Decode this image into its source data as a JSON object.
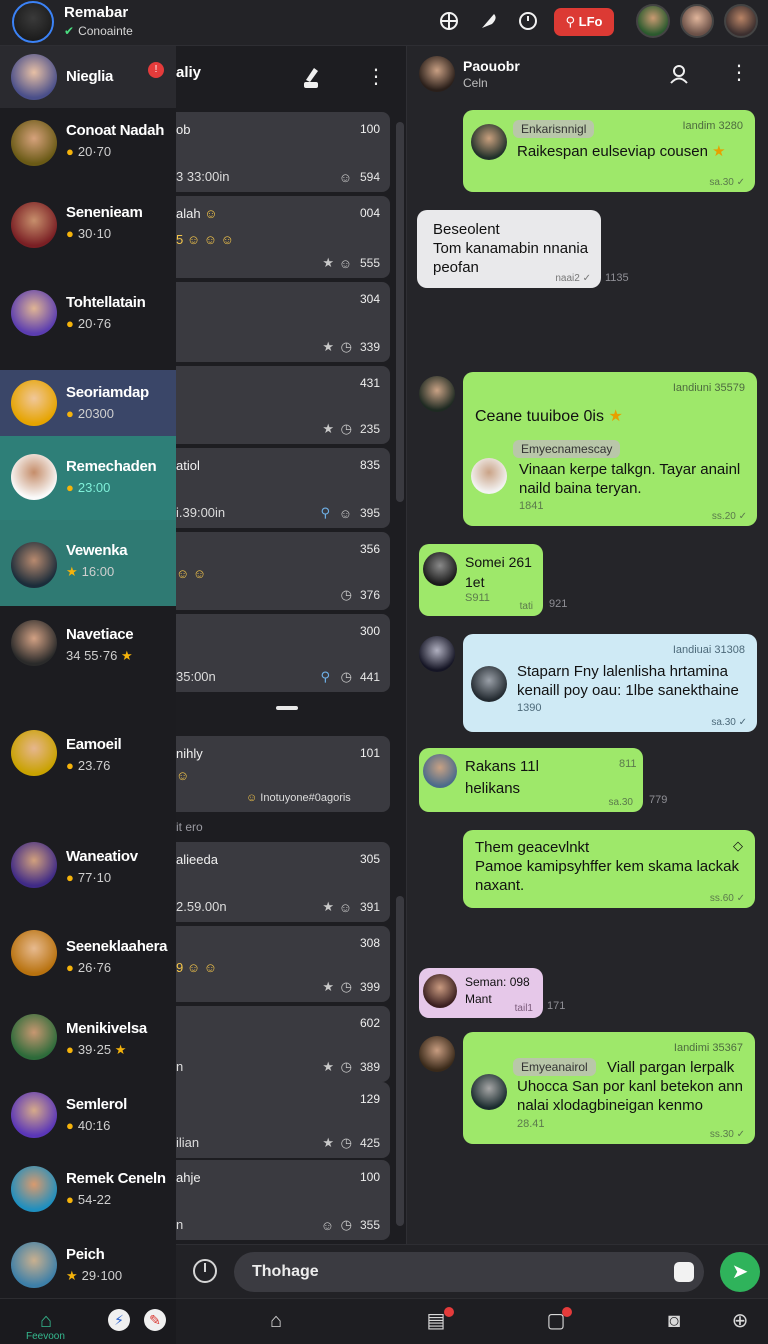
{
  "topbar": {
    "user_name": "Remabar",
    "user_status": "Conoainte",
    "live_label": "LFo"
  },
  "contacts": [
    {
      "name": "Nieglia",
      "sub": "",
      "badge": "!"
    },
    {
      "name": "Conoat Nadah",
      "sub": "20·70"
    },
    {
      "name": "Senenieam",
      "sub": "30·10"
    },
    {
      "name": "Tohtellatain",
      "sub": "20·76"
    },
    {
      "name": "Seoriamdap",
      "sub": "20300"
    },
    {
      "name": "Remechaden",
      "sub": "23:00"
    },
    {
      "name": "Vewenka",
      "sub": "16:00"
    },
    {
      "name": "Navetiace",
      "sub": "34 55·76"
    },
    {
      "name": "Eamoeil",
      "sub": "23.76"
    },
    {
      "name": "Waneatiov",
      "sub": "77·10"
    },
    {
      "name": "Seeneklaahera",
      "sub": "26·76"
    },
    {
      "name": "Menikivelsa",
      "sub": "39·25"
    },
    {
      "name": "Semlerol",
      "sub": "40:16"
    },
    {
      "name": "Remek Ceneln",
      "sub": "54-22"
    },
    {
      "name": "Peich",
      "sub": "29·100"
    }
  ],
  "middle": {
    "title": "aliy",
    "cards": [
      {
        "title": "ob",
        "num": "100",
        "sub": "3 33:00in",
        "count": "594"
      },
      {
        "title": "alah",
        "num": "004",
        "sub": "",
        "count": "555"
      },
      {
        "title": "",
        "num": "304",
        "sub": "",
        "count": "339"
      },
      {
        "title": "",
        "num": "431",
        "sub": "",
        "count": "235"
      },
      {
        "title": "atiol",
        "num": "835",
        "sub": "i.39:00in",
        "count": "395"
      },
      {
        "title": "",
        "num": "356",
        "sub": "",
        "count": "376"
      },
      {
        "title": "",
        "num": "300",
        "sub": "35:00n",
        "count": "441"
      },
      {
        "title": "nihly",
        "num": "101",
        "sub": "",
        "count": "Inotuyone#0agoris"
      },
      {
        "title": "alieeda",
        "num": "305",
        "sub": "2.59.00n",
        "count": "391"
      },
      {
        "title": "",
        "num": "308",
        "sub": "",
        "count": "399"
      },
      {
        "title": "",
        "num": "602",
        "sub": "n",
        "count": "389"
      },
      {
        "title": "",
        "num": "129",
        "sub": "ilian",
        "count": "425"
      },
      {
        "title": "ahje",
        "num": "100",
        "sub": "n",
        "count": "355"
      }
    ],
    "section_label": "it ero"
  },
  "chat": {
    "header_name": "Paouobr",
    "header_status": "Celn",
    "messages": [
      {
        "text": "Raikespan eulseviap cousen",
        "quote": "Enkarisnnigl",
        "header": "Iandim 3280",
        "meta": "sa.30"
      },
      {
        "text": "Beseolent\nTom kanamabin nnania\npeofan",
        "meta": "naai2",
        "outside": "1135"
      },
      {
        "text": "Ceane tuuiboe 0is",
        "header": "Iandiuni 35579",
        "quote": "Emyecnamescay",
        "quote_text": "Vinaan kerpe talkgn. Tayar anainl\nnaild baina teryan.",
        "stamp": "1841",
        "meta": "ss.20"
      },
      {
        "text": "Somei  261\n1et",
        "stamp": "S911",
        "meta": "tati",
        "outside": "921"
      },
      {
        "text": "Staparn Fny  lalenlisha hrtamina\nkenaill poy oau: 1lbe sanekthaine",
        "header": "Iandiuai 31308",
        "stamp": "1390",
        "meta": "sa.30"
      },
      {
        "text": "Rakans 11l\nhelikans",
        "num": "811",
        "meta": "sa.30",
        "outside": "779"
      },
      {
        "text": "Them geacevlnkt\nPamoe kamipsyhffer kem skama lackak\nnaxant.",
        "meta": "ss.60"
      },
      {
        "text": "Seman: 098\nMant",
        "meta": "tail1",
        "outside": "171"
      },
      {
        "text": "Viall pargan lerpalk\nUhocca San por kanl betekon ann\nnalai xlodagbineigan kenmo",
        "header": "Iandimi 35367",
        "quote": "Emyeanairol",
        "stamp": "28.41",
        "meta": "ss.30"
      }
    ]
  },
  "composer": {
    "placeholder": "Thohage"
  },
  "navbar": {
    "label": "Feevoon"
  }
}
